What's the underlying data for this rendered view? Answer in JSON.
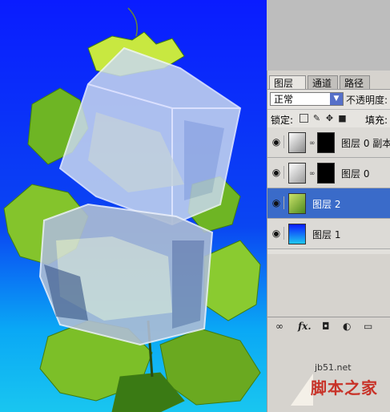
{
  "panel": {
    "tabs": [
      {
        "label": "图层",
        "close": "×"
      },
      {
        "label": "通道"
      },
      {
        "label": "路径"
      }
    ],
    "blend_mode": "正常",
    "opacity_label": "不透明度:",
    "lock_label": "锁定:",
    "fill_label": "填充:",
    "layers": [
      {
        "name": "图层 0 副本",
        "selected": false
      },
      {
        "name": "图层 0",
        "selected": false
      },
      {
        "name": "图层 2",
        "selected": true
      },
      {
        "name": "图层 1",
        "selected": false
      }
    ],
    "footer_icons": [
      "link-icon",
      "fx-icon",
      "mask-icon",
      "adjustment-icon",
      "folder-icon"
    ],
    "fx_label": "fx."
  },
  "watermark": {
    "site": "jb51.net",
    "brand": "脚本之家"
  },
  "colors": {
    "selected_row": "#3a6bc9",
    "canvas_top": "#0a1cff",
    "canvas_bottom": "#19c6f0"
  }
}
